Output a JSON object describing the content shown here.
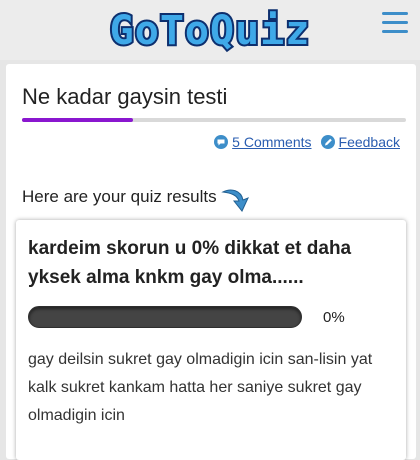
{
  "header": {
    "logo_text": "GoToQuiz",
    "logo_colors": {
      "fill": "#3fa9e8",
      "stroke": "#0d2f6e"
    },
    "menu_icon": "hamburger-menu-icon"
  },
  "quiz": {
    "title": "Ne kadar gaysin testi",
    "progress": 0.29,
    "accent_color": "#8a17cf"
  },
  "links": {
    "comments": "5 Comments",
    "feedback": "Feedback",
    "comments_icon": "comment-bubble-icon",
    "feedback_icon": "pencil-icon"
  },
  "results": {
    "intro": "Here are your quiz results",
    "intro_icon": "curved-arrow-down-icon",
    "title": "kardeim skorun u 0% dikkat et daha yksek alma knkm gay olma......",
    "score_percent": 0,
    "score_label": "0%",
    "description": "gay deilsin sukret gay olmadigin icin san-lisin yat kalk sukret kankam hatta her saniye sukret gay olmadigin icin"
  }
}
